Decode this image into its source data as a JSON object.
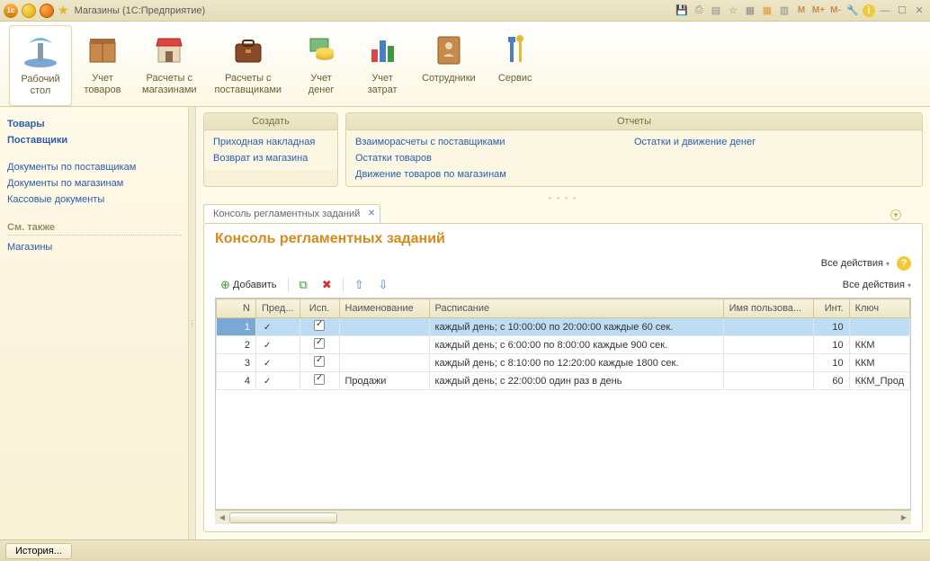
{
  "titlebar": {
    "title": "Магазины  (1С:Предприятие)",
    "buttons_m": [
      "M",
      "M+",
      "M-"
    ]
  },
  "ribbon": [
    {
      "id": "desktop",
      "label": "Рабочий\nстол",
      "active": true
    },
    {
      "id": "goods",
      "label": "Учет\nтоваров"
    },
    {
      "id": "shops",
      "label": "Расчеты с\nмагазинами"
    },
    {
      "id": "suppliers",
      "label": "Расчеты с\nпоставщиками"
    },
    {
      "id": "money",
      "label": "Учет\nденег"
    },
    {
      "id": "costs",
      "label": "Учет\nзатрат"
    },
    {
      "id": "staff",
      "label": "Сотрудники"
    },
    {
      "id": "service",
      "label": "Сервис"
    }
  ],
  "sidebar": {
    "primary": [
      "Товары",
      "Поставщики"
    ],
    "group1": [
      "Документы по поставщикам",
      "Документы по магазинам",
      "Кассовые документы"
    ],
    "see_also_heading": "См. также",
    "see_also": [
      "Магазины"
    ]
  },
  "cmd_panels": {
    "create_header": "Создать",
    "create_items": [
      "Приходная накладная",
      "Возврат из магазина"
    ],
    "reports_header": "Отчеты",
    "reports_col1": [
      "Взаиморасчеты с поставщиками",
      "Остатки товаров",
      "Движение товаров по магазинам"
    ],
    "reports_col2": [
      "Остатки и движение денег"
    ]
  },
  "tab": {
    "label": "Консоль регламентных заданий"
  },
  "page": {
    "title": "Консоль регламентных заданий",
    "all_actions": "Все действия"
  },
  "toolbar": {
    "add": "Добавить"
  },
  "table": {
    "headers": {
      "n": "N",
      "pred": "Пред...",
      "isp": "Исп.",
      "name": "Наименование",
      "schedule": "Расписание",
      "user": "Имя пользова...",
      "int": "Инт.",
      "key": "Ключ"
    },
    "rows": [
      {
        "n": "1",
        "pred": true,
        "isp": true,
        "name": "",
        "schedule": "каждый  день; с 10:00:00 по 20:00:00 каждые 60 сек.",
        "user": "",
        "int": "10",
        "key": "",
        "selected": true
      },
      {
        "n": "2",
        "pred": true,
        "isp": true,
        "name": "",
        "schedule": "каждый  день; с 6:00:00 по 8:00:00 каждые 900 сек.",
        "user": "",
        "int": "10",
        "key": "ККМ"
      },
      {
        "n": "3",
        "pred": true,
        "isp": true,
        "name": "",
        "schedule": "каждый  день; с 8:10:00 по 12:20:00 каждые 1800 сек.",
        "user": "",
        "int": "10",
        "key": "ККМ"
      },
      {
        "n": "4",
        "pred": true,
        "isp": true,
        "name": "Продажи",
        "schedule": "каждый  день; с 22:00:00 один раз в день",
        "user": "",
        "int": "60",
        "key": "ККМ_Прод"
      }
    ]
  },
  "statusbar": {
    "history": "История..."
  }
}
